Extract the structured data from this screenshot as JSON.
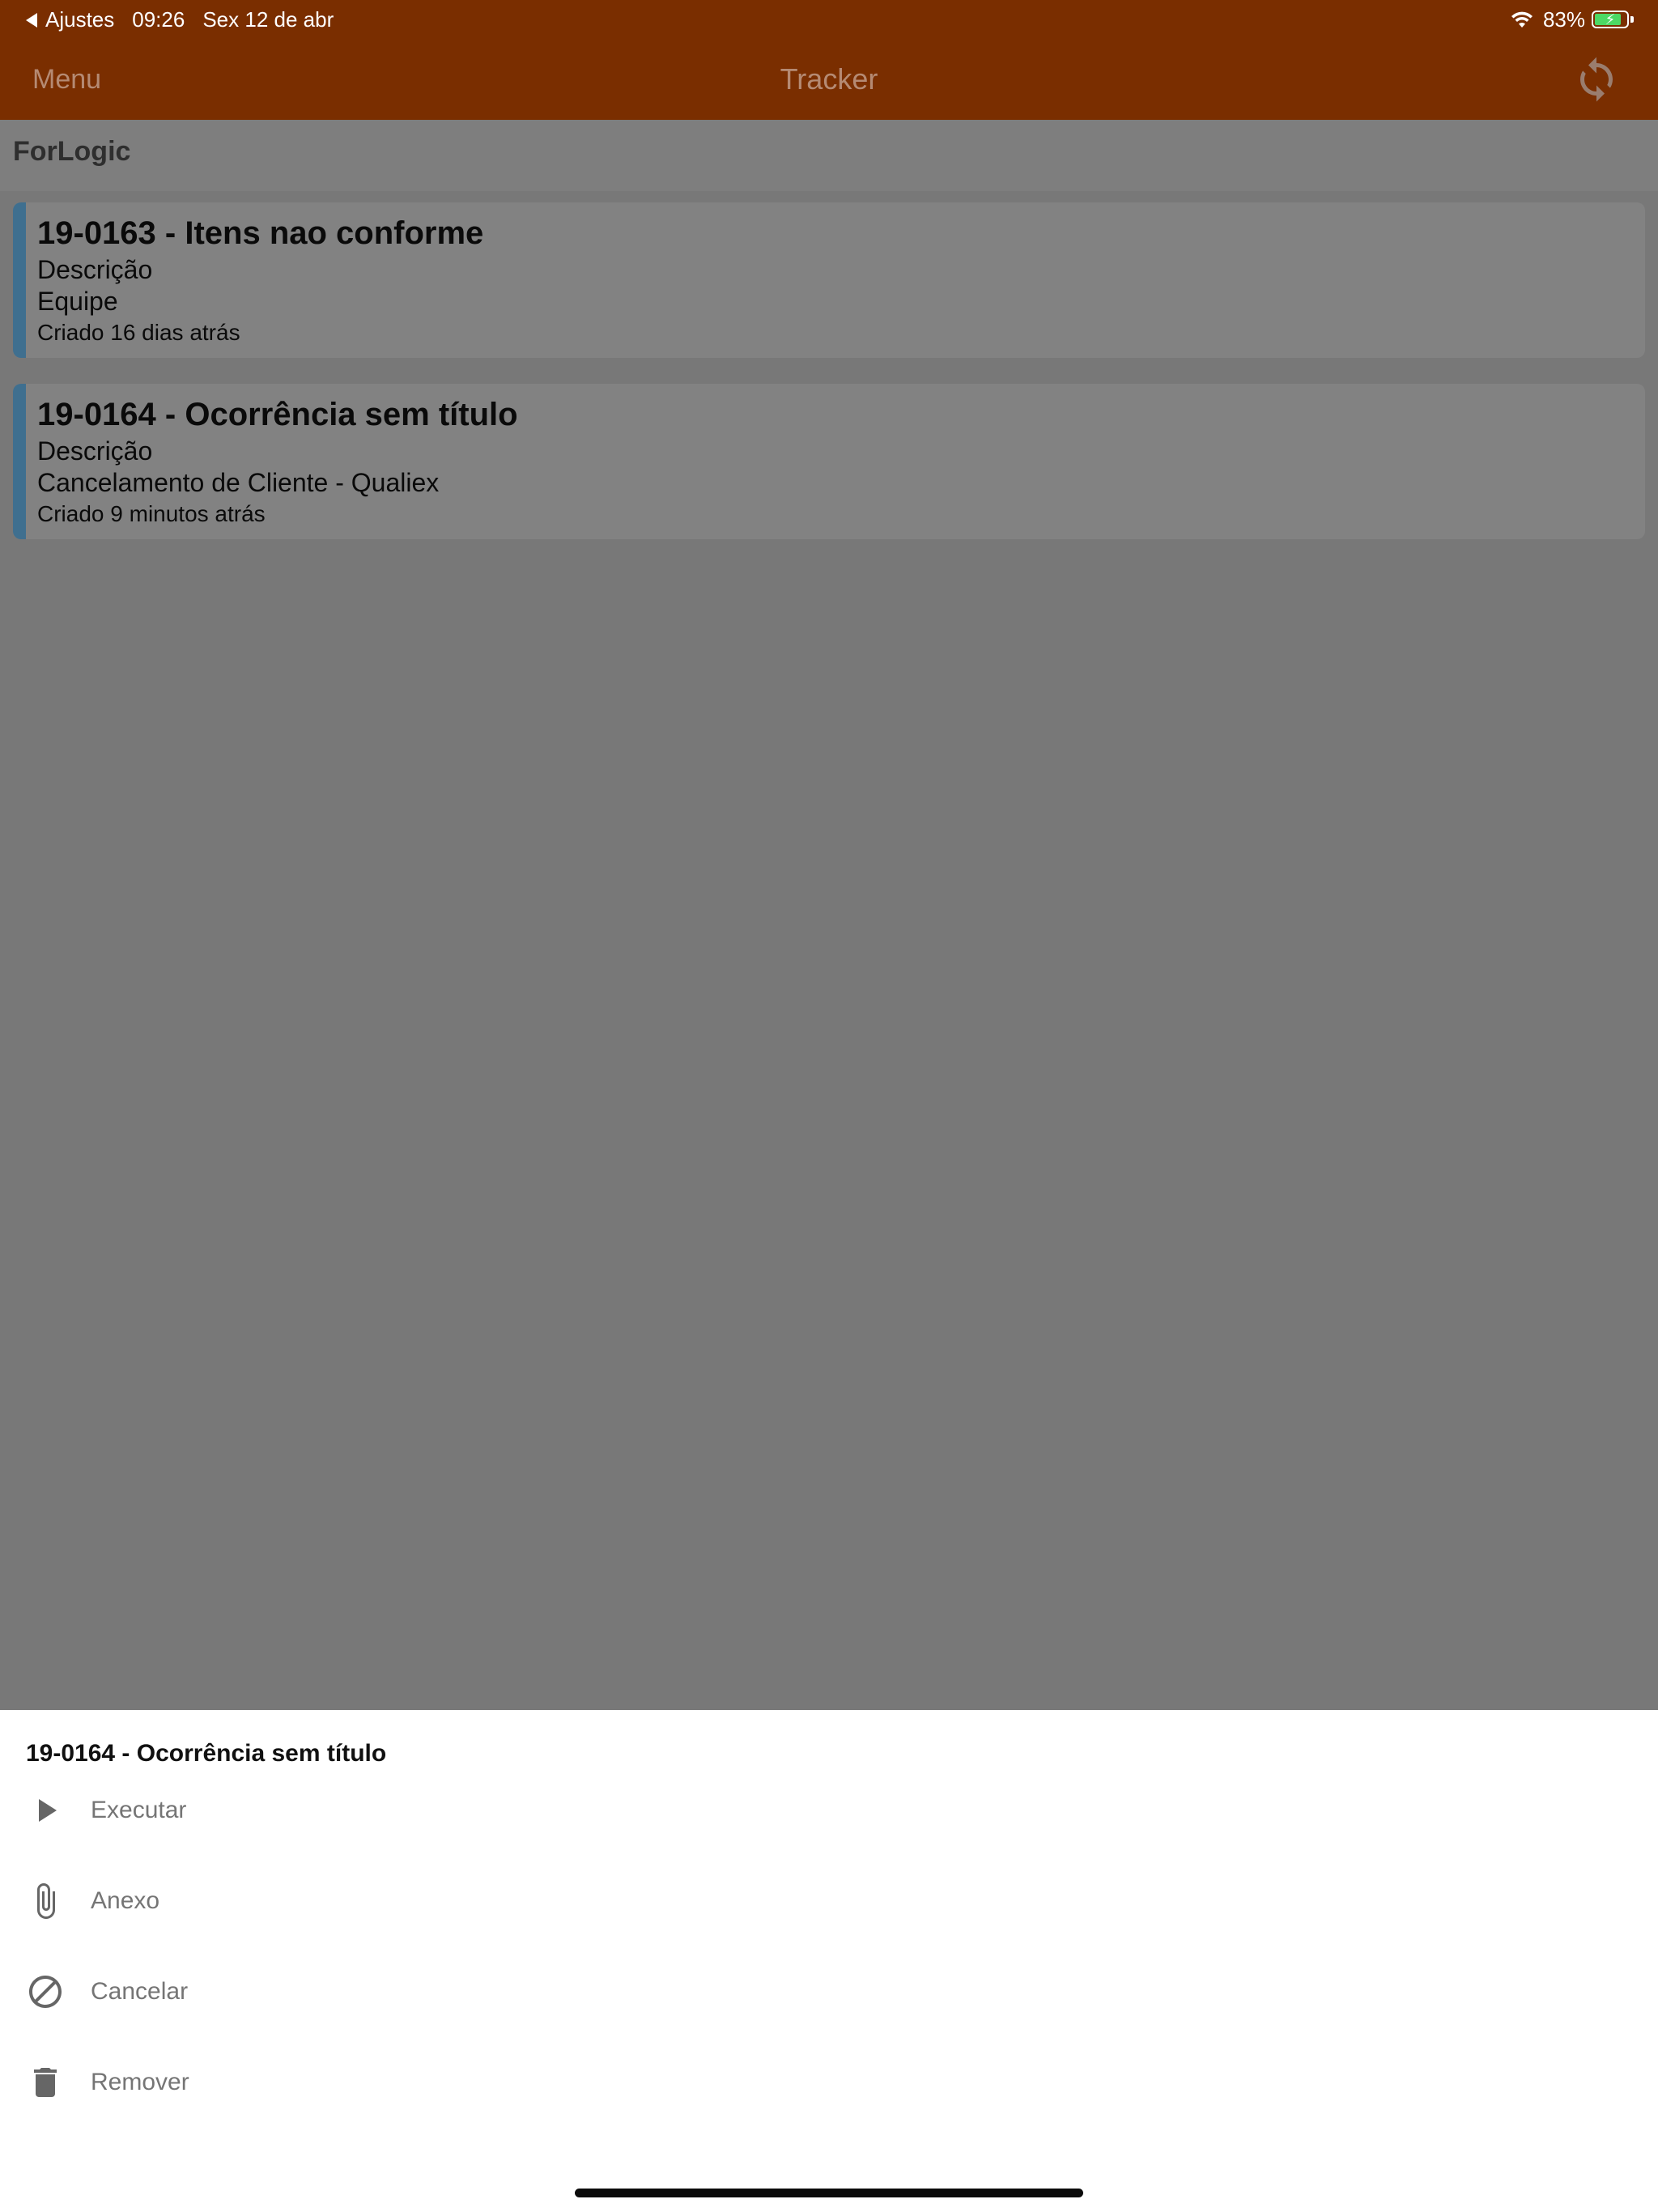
{
  "status_bar": {
    "back_app": "Ajustes",
    "time": "09:26",
    "date": "Sex 12 de abr",
    "battery_percent": "83%",
    "battery_level": 0.83,
    "battery_charging": true,
    "icons": [
      "back-arrow-icon",
      "wifi-icon",
      "battery-charging-icon"
    ]
  },
  "nav_bar": {
    "menu_label": "Menu",
    "title": "Tracker",
    "right_icon": "refresh-icon"
  },
  "group": {
    "name": "ForLogic"
  },
  "cards": [
    {
      "title": "19-0163 - Itens nao conforme",
      "description": "Descrição",
      "team": "Equipe",
      "created": "Criado 16 dias atrás"
    },
    {
      "title": "19-0164 - Ocorrência sem título",
      "description": "Descrição",
      "team": "Cancelamento de Cliente - Qualiex",
      "created": "Criado 9 minutos atrás"
    }
  ],
  "action_sheet": {
    "title": "19-0164 - Ocorrência sem título",
    "actions": [
      {
        "label": "Executar",
        "icon": "play-icon"
      },
      {
        "label": "Anexo",
        "icon": "paperclip-icon"
      },
      {
        "label": "Cancelar",
        "icon": "cancel-icon"
      },
      {
        "label": "Remover",
        "icon": "trash-icon"
      }
    ]
  },
  "colors": {
    "nav_bar": "#7a2e00",
    "card_accent": "#3f6f8f",
    "overlay_background": "#787878",
    "battery_green": "#4cd964"
  }
}
